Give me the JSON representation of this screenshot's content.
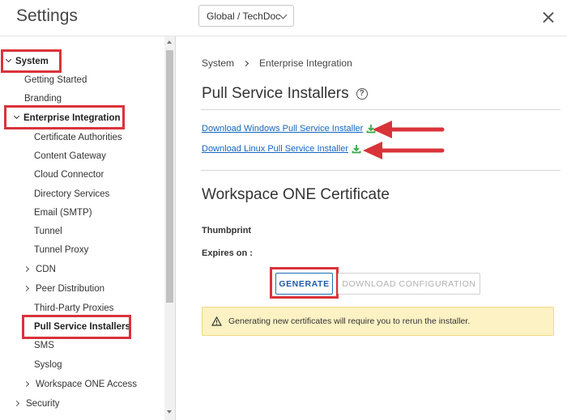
{
  "header": {
    "title": "Settings",
    "org_selector": "Global / TechDoc"
  },
  "sidebar": {
    "system": "System",
    "getting_started": "Getting Started",
    "branding": "Branding",
    "enterprise_integration": "Enterprise Integration",
    "certificate_authorities": "Certificate Authorities",
    "content_gateway": "Content Gateway",
    "cloud_connector": "Cloud Connector",
    "directory_services": "Directory Services",
    "email_smtp": "Email (SMTP)",
    "tunnel": "Tunnel",
    "tunnel_proxy": "Tunnel Proxy",
    "cdn": "CDN",
    "peer_distribution": "Peer Distribution",
    "third_party_proxies": "Third-Party Proxies",
    "pull_service_installers": "Pull Service Installers",
    "sms": "SMS",
    "syslog": "Syslog",
    "workspace_one_access": "Workspace ONE Access",
    "security": "Security"
  },
  "breadcrumb": {
    "root": "System",
    "current": "Enterprise Integration"
  },
  "main": {
    "section_title": "Pull Service Installers",
    "download_windows": "Download Windows Pull Service Installer",
    "download_linux": "Download Linux Pull Service Installer",
    "cert_title": "Workspace ONE Certificate",
    "thumbprint_label": "Thumbprint",
    "expires_label": "Expires on :",
    "generate_button": "GENERATE",
    "download_config_button": "DOWNLOAD CONFIGURATION",
    "warning_text": "Generating new certificates will require you to rerun the installer."
  },
  "colors": {
    "highlight": "#d9333a",
    "link": "#1565c0",
    "download_icon": "#3aa843",
    "warning_bg": "#fdf2c4"
  },
  "icons": {
    "download": "download-icon",
    "help": "help-icon",
    "warning": "warning-icon",
    "close": "close-icon"
  }
}
